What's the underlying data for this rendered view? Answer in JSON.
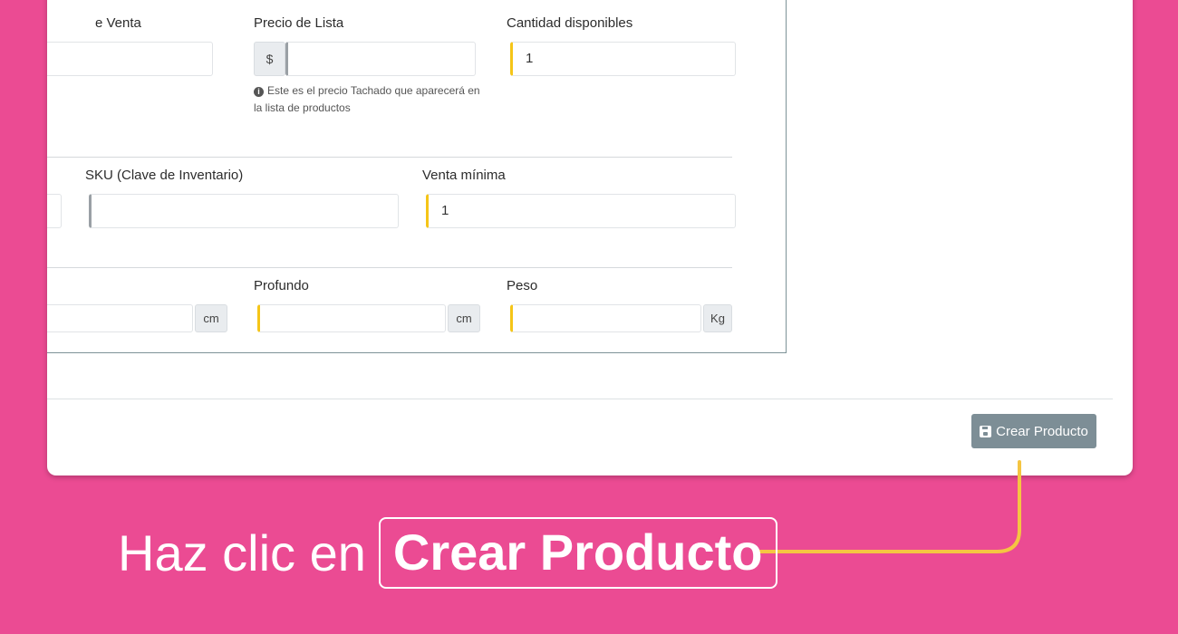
{
  "form": {
    "sale_price_label": "e Venta",
    "list_price_label": "Precio de Lista",
    "list_price_prefix": "$",
    "list_price_value": "",
    "list_price_help": "Este es el precio Tachado que aparecerá en la lista de productos",
    "quantity_label": "Cantidad disponibles",
    "quantity_value": "1",
    "sku_label": "SKU (Clave de Inventario)",
    "sku_value": "",
    "min_sale_label": "Venta mínima",
    "min_sale_value": "1",
    "depth_label": "Profundo",
    "weight_label": "Peso",
    "unit_cm": "cm",
    "unit_kg": "Kg"
  },
  "footer": {
    "create_button_label": "Crear Producto"
  },
  "caption": {
    "lead": "Haz clic en",
    "highlight": "Crear Producto"
  },
  "colors": {
    "background": "#eb4b93",
    "accent_required": "#f5c518",
    "button": "#7d8e96",
    "connector": "#f5c542"
  }
}
